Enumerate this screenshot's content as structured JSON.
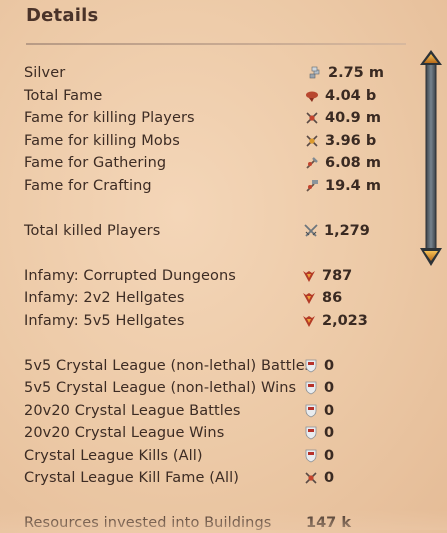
{
  "panel": {
    "title": "Details"
  },
  "colors": {
    "background": "#ecc9a9",
    "text": "#3a2a22",
    "scrollbar_accent": "#e8a23a",
    "scrollbar_track": "#5f6a73"
  },
  "stats": [
    {
      "label": "Silver",
      "value": "2.75 m",
      "icon": "silver-coins-icon"
    },
    {
      "label": "Total Fame",
      "value": "4.04 b",
      "icon": "fame-icon"
    },
    {
      "label": "Fame for killing Players",
      "value": "40.9 m",
      "icon": "pvp-fame-icon"
    },
    {
      "label": "Fame for killing Mobs",
      "value": "3.96 b",
      "icon": "pve-fame-icon"
    },
    {
      "label": "Fame for Gathering",
      "value": "6.08 m",
      "icon": "gathering-fame-icon"
    },
    {
      "label": "Fame for Crafting",
      "value": "19.4 m",
      "icon": "crafting-fame-icon"
    },
    {
      "label": "Total killed Players",
      "value": "1,279",
      "icon": "crossed-swords-icon"
    },
    {
      "label": "Infamy: Corrupted Dungeons",
      "value": "787",
      "icon": "infamy-icon"
    },
    {
      "label": "Infamy: 2v2 Hellgates",
      "value": "86",
      "icon": "infamy-icon"
    },
    {
      "label": "Infamy: 5v5 Hellgates",
      "value": "2,023",
      "icon": "infamy-icon"
    },
    {
      "label": "5v5 Crystal League (non-lethal) Battles",
      "value": "0",
      "icon": "crystal-league-shield-icon"
    },
    {
      "label": "5v5 Crystal League (non-lethal) Wins",
      "value": "0",
      "icon": "crystal-league-shield-icon"
    },
    {
      "label": "20v20 Crystal League Battles",
      "value": "0",
      "icon": "crystal-league-shield-icon"
    },
    {
      "label": "20v20 Crystal League Wins",
      "value": "0",
      "icon": "crystal-league-shield-icon"
    },
    {
      "label": "Crystal League Kills (All)",
      "value": "0",
      "icon": "crystal-league-shield-icon"
    },
    {
      "label": "Crystal League Kill Fame (All)",
      "value": "0",
      "icon": "pvp-fame-icon"
    },
    {
      "label": "Resources invested into Buildings",
      "value": "147 k",
      "icon": ""
    }
  ]
}
